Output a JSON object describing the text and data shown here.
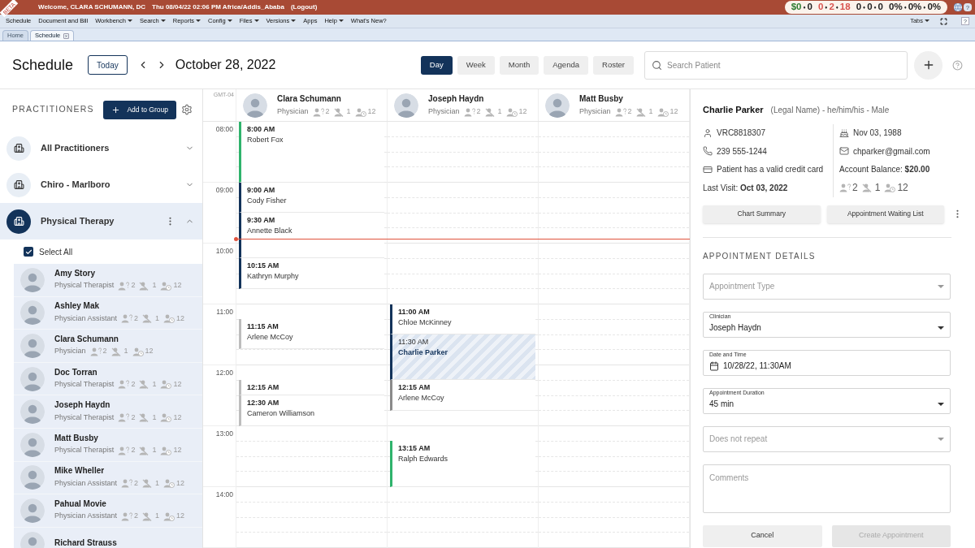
{
  "top_bar": {
    "ribbon": "BETA",
    "welcome": "Welcome, CLARA SCHUMANN, DC",
    "datetime": "Thu 08/04/22 02:06 PM Africa/Addis_Ababa",
    "logout": "(Logout)",
    "stats_separator": "♦",
    "stats": [
      [
        {
          "text": "$0",
          "color": "#2e7d32"
        },
        {
          "text": "0",
          "color": "#222222"
        }
      ],
      [
        {
          "text": "0",
          "color": "#d9534f"
        },
        {
          "text": "2",
          "color": "#d9534f"
        },
        {
          "text": "18",
          "color": "#d9534f"
        }
      ],
      [
        {
          "text": "0",
          "color": "#222222"
        },
        {
          "text": "0",
          "color": "#222222"
        },
        {
          "text": "0",
          "color": "#222222"
        }
      ],
      [
        {
          "text": "0%",
          "color": "#222222"
        },
        {
          "text": "0%",
          "color": "#222222"
        },
        {
          "text": "0%",
          "color": "#222222"
        }
      ]
    ],
    "help": "?"
  },
  "menu": {
    "items": [
      {
        "label": "Schedule",
        "dropdown": false
      },
      {
        "label": "Document and Bill",
        "dropdown": false
      },
      {
        "label": "Workbench",
        "dropdown": true
      },
      {
        "label": "Search",
        "dropdown": true
      },
      {
        "label": "Reports",
        "dropdown": true
      },
      {
        "label": "Config",
        "dropdown": true
      },
      {
        "label": "Files",
        "dropdown": true
      },
      {
        "label": "Versions",
        "dropdown": true
      },
      {
        "label": "Apps",
        "dropdown": false
      },
      {
        "label": "Help",
        "dropdown": true
      },
      {
        "label": "What's New?",
        "dropdown": false
      }
    ],
    "tabs_menu": "Tabs",
    "help": "?"
  },
  "tabs": [
    {
      "label": "Home",
      "selected": false,
      "closable": false
    },
    {
      "label": "Schedule",
      "selected": true,
      "closable": true
    }
  ],
  "toolbar": {
    "title": "Schedule",
    "today": "Today",
    "date": "October 28, 2022",
    "views": [
      {
        "label": "Day",
        "selected": true
      },
      {
        "label": "Week",
        "selected": false
      },
      {
        "label": "Month",
        "selected": false
      },
      {
        "label": "Agenda",
        "selected": false
      },
      {
        "label": "Roster",
        "selected": false
      }
    ],
    "search": {
      "placeholder": "Search Patient"
    }
  },
  "sidebar": {
    "title": "PRACTITIONERS",
    "add_button": "Add to Group",
    "groups": [
      {
        "label": "All Practitioners",
        "selected": false,
        "expanded": false
      },
      {
        "label": "Chiro - Marlboro",
        "selected": false,
        "expanded": false
      },
      {
        "label": "Physical Therapy",
        "selected": true,
        "expanded": true
      }
    ],
    "select_all": {
      "label": "Select All",
      "checked": true
    },
    "practitioners": [
      {
        "name": "Amy Story",
        "role": "Physical Therapist",
        "selected": true,
        "stats": [
          "2",
          "1",
          "12"
        ]
      },
      {
        "name": "Ashley Mak",
        "role": "Physician Assistant",
        "selected": true,
        "stats": [
          "2",
          "1",
          "12"
        ]
      },
      {
        "name": "Clara Schumann",
        "role": "Physician",
        "selected": true,
        "stats": [
          "2",
          "1",
          "12"
        ]
      },
      {
        "name": "Doc Torran",
        "role": "Physical Therapist",
        "selected": true,
        "stats": [
          "2",
          "1",
          "12"
        ]
      },
      {
        "name": "Joseph Haydn",
        "role": "Physical Therapist",
        "selected": true,
        "stats": [
          "2",
          "1",
          "12"
        ]
      },
      {
        "name": "Matt Busby",
        "role": "Physical Therapist",
        "selected": true,
        "stats": [
          "2",
          "1",
          "12"
        ]
      },
      {
        "name": "Mike Wheller",
        "role": "Physician Assistant",
        "selected": true,
        "stats": [
          "2",
          "1",
          "12"
        ]
      },
      {
        "name": "Pahual Movie",
        "role": "Physician Assistant",
        "selected": true,
        "stats": [
          "2",
          "1",
          "12"
        ]
      },
      {
        "name": "Richard Strauss",
        "selected": true
      }
    ]
  },
  "calendar": {
    "timezone": "GMT-04",
    "hours": [
      "08:00",
      "09:00",
      "10:00",
      "11:00",
      "12:00",
      "13:00",
      "14:00"
    ],
    "columns": [
      {
        "name": "Clara Schumann",
        "role": "Physician",
        "stats": [
          "2",
          "1",
          "12"
        ],
        "events": [
          {
            "time": "8:00 AM",
            "patient": "Robert Fox",
            "color": "#2fb36c",
            "selected": false
          },
          {
            "time": "9:00 AM",
            "patient": "Cody Fisher",
            "color": "#13335a",
            "selected": false
          },
          {
            "time": "9:30 AM",
            "patient": "Annette Black",
            "color": "#13335a",
            "selected": false
          },
          {
            "time": "10:15 AM",
            "patient": "Kathryn Murphy",
            "color": "#13335a",
            "selected": false
          },
          {
            "time": "11:15 AM",
            "patient": "Arlene McCoy",
            "color": "#bdbdbd",
            "selected": false
          },
          {
            "time": "12:15 AM",
            "color": "#bdbdbd",
            "selected": false
          },
          {
            "time": "12:30 AM",
            "patient": "Cameron Williamson",
            "color": "#bdbdbd",
            "selected": false
          }
        ]
      },
      {
        "name": "Joseph Haydn",
        "role": "Physician",
        "stats": [
          "2",
          "1",
          "12"
        ],
        "events": [
          {
            "time": "11:00 AM",
            "patient": "Chloe McKinney",
            "color": "#13335a",
            "selected": false
          },
          {
            "time": "11:30 AM",
            "patient": "Charlie Parker",
            "color": "#13335a",
            "selected": true
          },
          {
            "time": "12:15 AM",
            "patient": "Arlene McCoy",
            "color": "#8a8a8a",
            "selected": false
          },
          {
            "time": "13:15 AM",
            "patient": "Ralph Edwards",
            "color": "#2fb36c",
            "selected": false
          }
        ]
      },
      {
        "name": "Matt Busby",
        "role": "Physician",
        "stats": [
          "2",
          "1",
          "12"
        ]
      }
    ]
  },
  "patient": {
    "name": "Charlie Parker",
    "details": "(Legal Name) - he/him/his - Male",
    "info": [
      {
        "kind": "id",
        "text": "VRC8818307"
      },
      {
        "kind": "birthday",
        "text": "Nov 03, 1988"
      },
      {
        "kind": "phone",
        "text": "239 555-1244"
      },
      {
        "kind": "email",
        "text": "chparker@gmail.com"
      },
      {
        "kind": "card",
        "text": "Patient has a valid credit card"
      },
      {
        "kind": "plain",
        "text": "Account Balance: **$20.00**"
      },
      {
        "kind": "plain",
        "text": "Last Visit: **Oct 03, 2022**"
      },
      {
        "kind": "stats",
        "stats": [
          "2",
          "1",
          "12"
        ]
      }
    ],
    "buttons": [
      "Chart Summary",
      "Appointment Waiting List"
    ]
  },
  "appointment": {
    "title": "APPOINTMENT DETAILS",
    "fields": [
      {
        "kind": "select",
        "placeholder": "Appointment Type"
      },
      {
        "kind": "select",
        "label": "Clinician",
        "value": "Joseph Haydn"
      },
      {
        "kind": "date",
        "label": "Date and Time",
        "value": "10/28/22, 11:30AM"
      },
      {
        "kind": "select",
        "label": "Appointment Duration",
        "value": "45 min"
      },
      {
        "kind": "select",
        "placeholder": "Does not repeat"
      },
      {
        "kind": "textarea",
        "placeholder": "Comments"
      }
    ],
    "buttons": [
      {
        "label": "Cancel",
        "disabled": false
      },
      {
        "label": "Create Appointment",
        "disabled": true
      }
    ]
  }
}
